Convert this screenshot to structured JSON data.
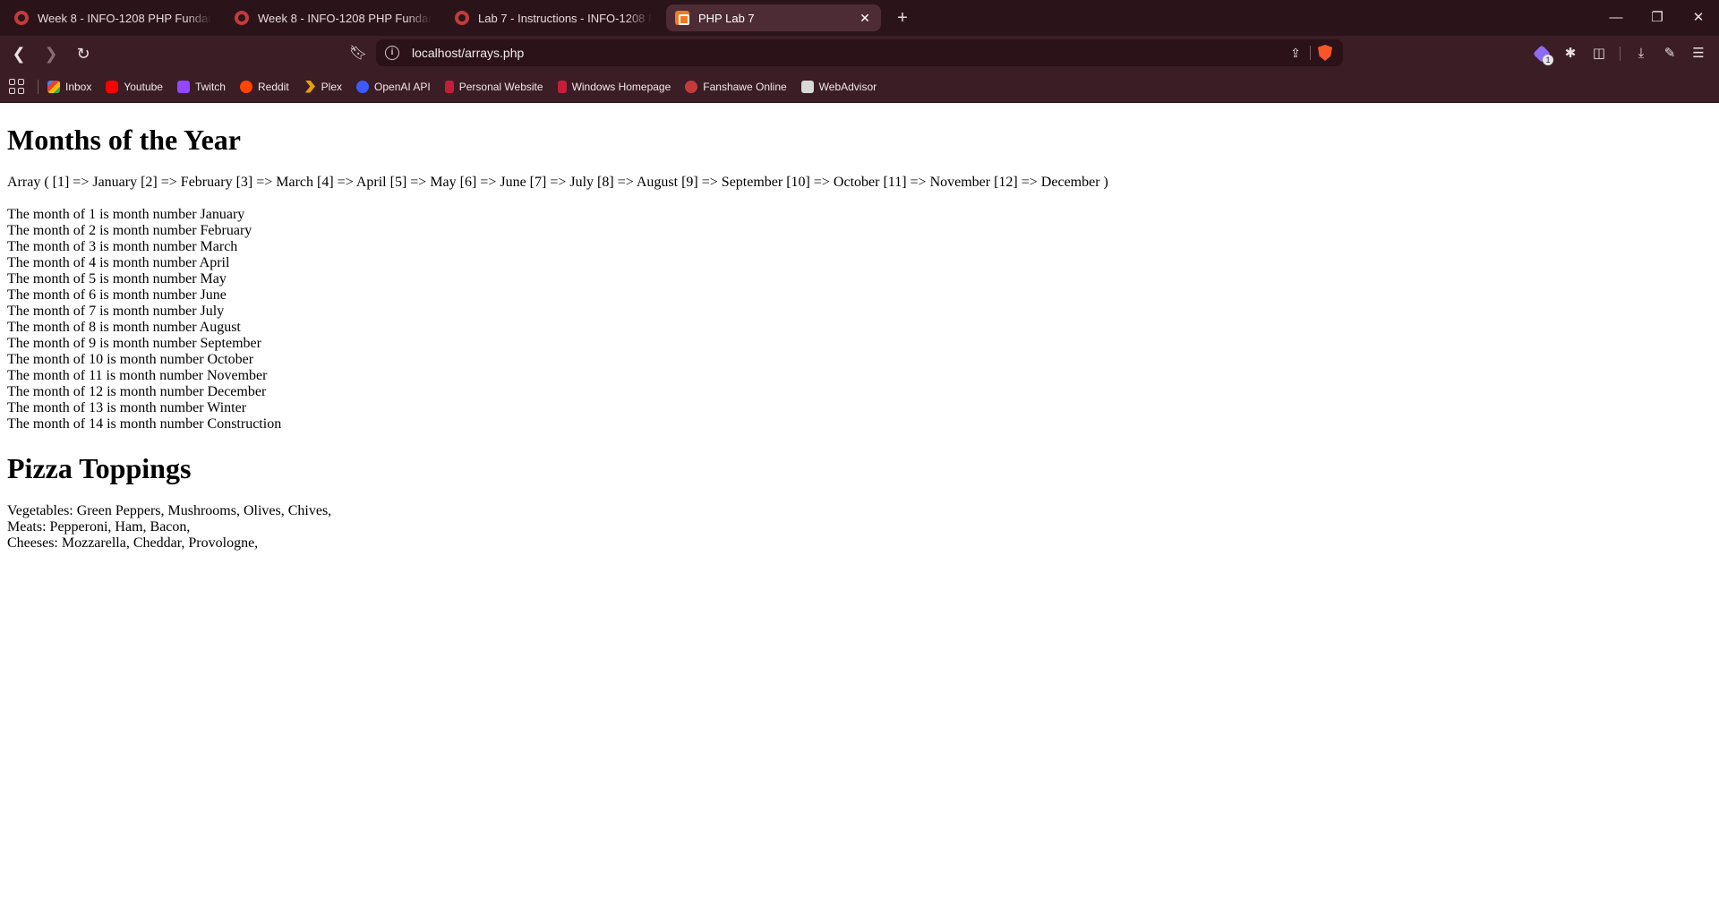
{
  "browser": {
    "tabs": [
      {
        "title": "Week 8 - INFO-1208 PHP Fundamentals",
        "active": false,
        "icon": "fol"
      },
      {
        "title": "Week 8 - INFO-1208 PHP Fundamentals",
        "active": false,
        "icon": "fol"
      },
      {
        "title": "Lab 7 - Instructions - INFO-1208 PHP",
        "active": false,
        "icon": "fol"
      },
      {
        "title": "PHP Lab 7",
        "active": true,
        "icon": "php"
      }
    ],
    "address": {
      "url": "localhost/arrays.php"
    },
    "extensions_badge": "1",
    "bookmarks": [
      {
        "label": "Inbox",
        "icon": "gmail"
      },
      {
        "label": "Youtube",
        "icon": "youtube"
      },
      {
        "label": "Twitch",
        "icon": "twitch"
      },
      {
        "label": "Reddit",
        "icon": "reddit"
      },
      {
        "label": "Plex",
        "icon": "plex"
      },
      {
        "label": "OpenAI API",
        "icon": "openai"
      },
      {
        "label": "Personal Website",
        "icon": "pw"
      },
      {
        "label": "Windows Homepage",
        "icon": "win"
      },
      {
        "label": "Fanshawe Online",
        "icon": "fol"
      },
      {
        "label": "WebAdvisor",
        "icon": "wa"
      }
    ]
  },
  "content": {
    "months_heading": "Months of the Year",
    "array_dump": "Array ( [1] => January [2] => February [3] => March [4] => April [5] => May [6] => June [7] => July [8] => August [9] => September [10] => October [11] => November [12] => December )",
    "month_lines": [
      "The month of 1 is month number January",
      "The month of 2 is month number February",
      "The month of 3 is month number March",
      "The month of 4 is month number April",
      "The month of 5 is month number May",
      "The month of 6 is month number June",
      "The month of 7 is month number July",
      "The month of 8 is month number August",
      "The month of 9 is month number September",
      "The month of 10 is month number October",
      "The month of 11 is month number November",
      "The month of 12 is month number December",
      "The month of 13 is month number Winter",
      "The month of 14 is month number Construction"
    ],
    "pizza_heading": "Pizza Toppings",
    "topping_lines": [
      "Vegetables: Green Peppers, Mushrooms, Olives, Chives,",
      "Meats: Pepperoni, Ham, Bacon,",
      "Cheeses: Mozzarella, Cheddar, Provologne,"
    ]
  }
}
